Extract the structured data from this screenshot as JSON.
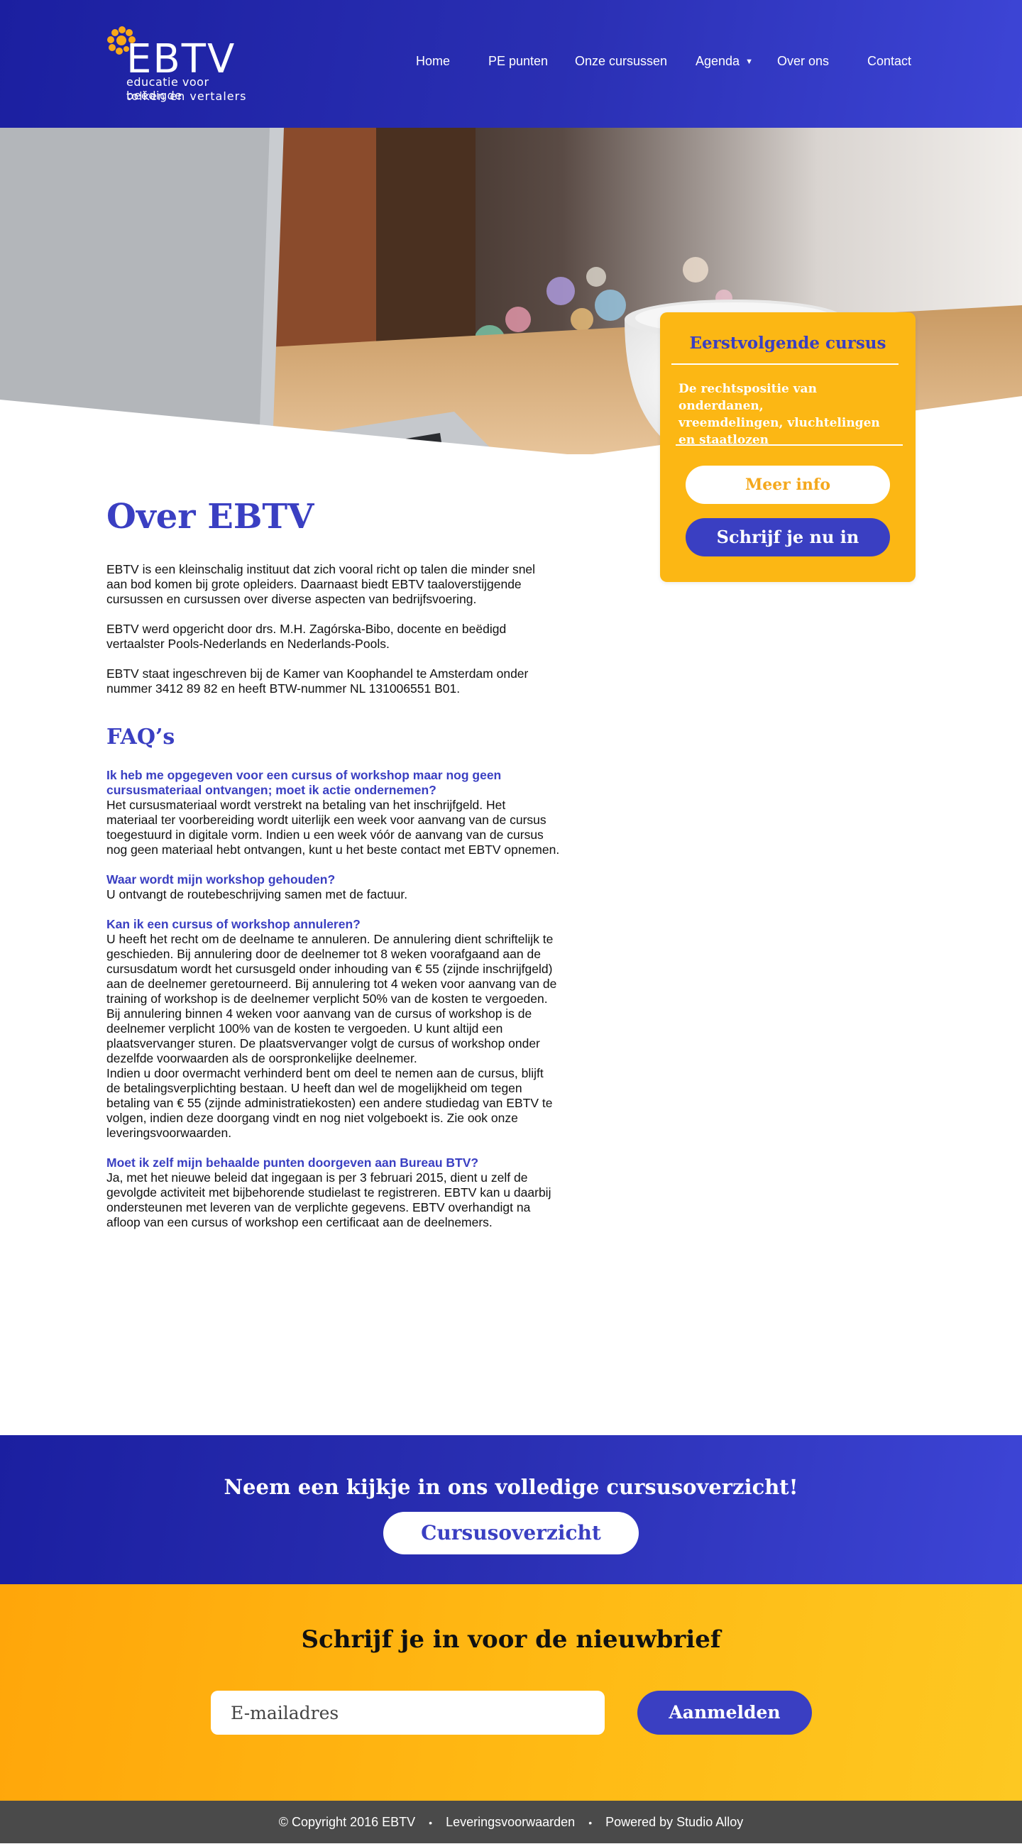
{
  "header": {
    "logo_text": "EBTV",
    "logo_tagline_1": "educatie voor beëdigde",
    "logo_tagline_2": "tolken en vertalers",
    "nav": [
      {
        "label": "Home"
      },
      {
        "label": "PE punten"
      },
      {
        "label": "Onze cursussen"
      },
      {
        "label": "Agenda"
      },
      {
        "label": "Over ons"
      },
      {
        "label": "Contact"
      }
    ]
  },
  "sidebar": {
    "title": "Eerstvolgende cursus",
    "course_lines": [
      "De rechtspositie van onderdanen,",
      "vreemdelingen, vluchtelingen",
      "en staatlozen"
    ],
    "more_info": "Meer info",
    "enroll": "Schrijf je nu in"
  },
  "content": {
    "title": "Over EBTV",
    "paragraphs": [
      [
        "EBTV is een kleinschalig instituut dat zich vooral richt op talen die minder snel",
        "aan bod komen bij grote opleiders. Daarnaast biedt EBTV taaloverstijgende",
        "cursussen en cursussen over diverse aspecten van bedrijfsvoering."
      ],
      [
        "EBTV werd opgericht door drs. M.H. Zagórska-Bibo, docente en beëdigd",
        "vertaalster Pools-Nederlands en Nederlands-Pools."
      ],
      [
        "EBTV staat ingeschreven bij de Kamer van Koophandel te Amsterdam onder",
        "nummer 3412 89 82 en heeft BTW-nummer NL 131006551 B01."
      ]
    ],
    "faq_title": "FAQ’s",
    "faqs": [
      {
        "question": [
          "Ik heb me opgegeven voor een cursus of workshop maar nog geen",
          "cursusmateriaal ontvangen; moet ik actie ondernemen?"
        ],
        "answer": [
          "Het cursusmateriaal wordt verstrekt na betaling van het inschrijfgeld. Het",
          "materiaal ter voorbereiding wordt uiterlijk een week voor aanvang van de cursus",
          "toegestuurd in digitale vorm. Indien u een week vóór de aanvang van de cursus",
          "nog geen materiaal hebt ontvangen, kunt u het beste contact met EBTV opnemen."
        ]
      },
      {
        "question": [
          "Waar wordt mijn workshop gehouden?"
        ],
        "answer": [
          "U ontvangt de routebeschrijving samen met de factuur."
        ]
      },
      {
        "question": [
          "Kan ik een cursus of workshop annuleren?"
        ],
        "answer": [
          "U  heeft het recht om de deelname te annuleren. De annulering dient schriftelijk te",
          "geschieden. Bij annulering door de deelnemer tot 8 weken voorafgaand aan de",
          "cursusdatum wordt het cursusgeld onder inhouding van € 55 (zijnde inschrijfgeld)",
          "aan de deelnemer geretourneerd. Bij annulering tot 4 weken voor aanvang van de",
          "training of workshop is de deelnemer verplicht 50% van de kosten te vergoeden.",
          "Bij annulering binnen 4 weken voor aanvang van de cursus of workshop is de",
          "deelnemer verplicht 100% van de kosten te vergoeden. U kunt altijd een",
          "plaatsvervanger sturen. De plaatsvervanger volgt de cursus of workshop onder",
          "dezelfde voorwaarden als de oorspronkelijke deelnemer.",
          "Indien u door overmacht verhinderd bent om deel te nemen aan de cursus, blijft",
          "de betalingsverplichting bestaan. U heeft dan wel de mogelijkheid om tegen",
          "betaling van € 55 (zijnde administratiekosten) een andere studiedag van EBTV te",
          "volgen, indien deze doorgang vindt en nog niet volgeboekt is. Zie ook onze",
          "leveringsvoorwaarden."
        ]
      },
      {
        "question": [
          "Moet ik zelf mijn behaalde punten doorgeven aan Bureau BTV?"
        ],
        "answer": [
          "Ja, met het nieuwe beleid dat ingegaan is per 3 februari 2015, dient u zelf de",
          "gevolgde activiteit met bijbehorende studielast te registreren. EBTV kan u daarbij",
          "ondersteunen met leveren van de verplichte gegevens. EBTV overhandigt na",
          "afloop van een cursus of workshop een certificaat aan de deelnemers."
        ]
      }
    ]
  },
  "cta": {
    "title": "Neem een kijkje in ons volledige cursusoverzicht!",
    "button": "Cursusoverzicht"
  },
  "newsletter": {
    "title": "Schrijf je in voor de nieuwbrief",
    "placeholder": "E-mailadres",
    "button": "Aanmelden"
  },
  "footer": {
    "copyright": "© Copyright  2016  EBTV",
    "terms": "Leveringsvoorwaarden",
    "powered": "Powered by Studio Alloy"
  },
  "colors": {
    "brand_blue": "#3a3fc2",
    "header_blue_dark": "#1b1fa0",
    "brand_yellow": "#fcb714",
    "footer_grey": "#4a4a4a"
  },
  "icons": [
    "ebtv-flower-logo-icon",
    "chevron-down-icon"
  ]
}
